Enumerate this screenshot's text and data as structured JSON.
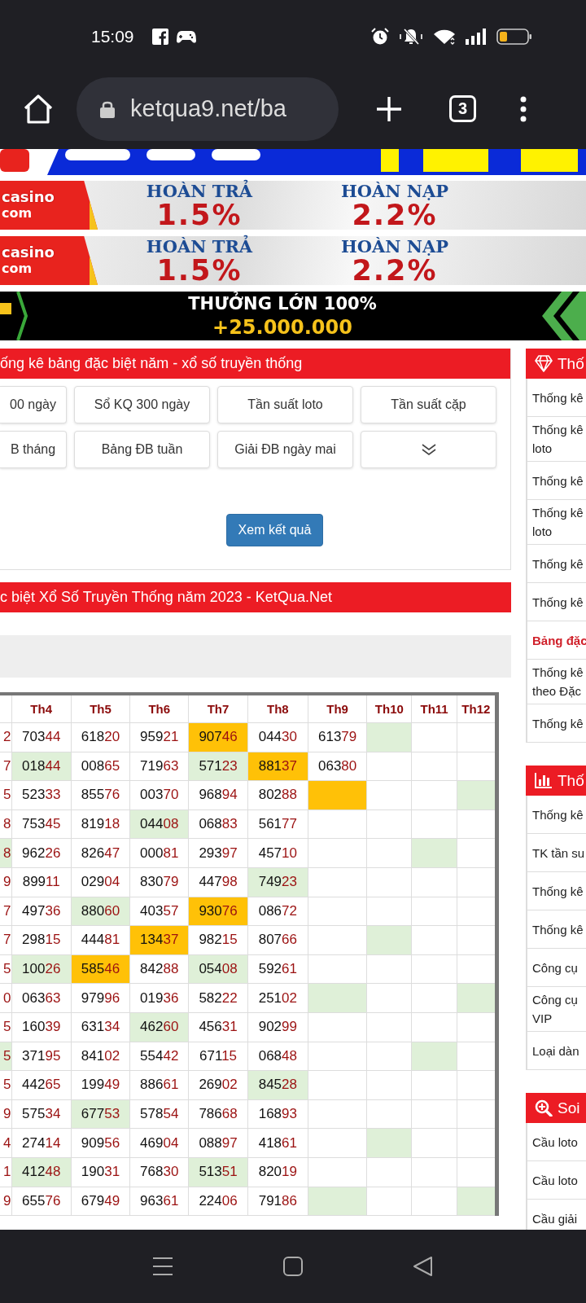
{
  "status_bar": {
    "time": "15:09"
  },
  "browser": {
    "url": "ketqua9.net/ba",
    "tab_count": "3"
  },
  "banners": [
    {
      "kind": "strip"
    },
    {
      "kind": "casino",
      "logo": "casino",
      "logo_sub": "com",
      "offers": [
        {
          "title": "HOÀN TRẢ",
          "value": "1.5%"
        },
        {
          "title": "HOÀN NẠP",
          "value": "2.2%"
        }
      ]
    },
    {
      "kind": "casino",
      "logo": "casino",
      "logo_sub": "com",
      "offers": [
        {
          "title": "HOÀN TRẢ",
          "value": "1.5%"
        },
        {
          "title": "HOÀN NẠP",
          "value": "2.2%"
        }
      ]
    },
    {
      "kind": "bonus",
      "title": "THƯỞNG LỚN 100%",
      "amount": "+25.000.000"
    }
  ],
  "filter_panel": {
    "title": "ống kê bảng đặc biệt năm - xổ số truyền thống",
    "options": [
      "00 ngày",
      "Sổ KQ 300 ngày",
      "Tần suất loto",
      "Tần suất cặp",
      "B tháng",
      "Bảng ĐB tuần",
      "Giải ĐB ngày mai"
    ],
    "submit": "Xem kết quả"
  },
  "table_panel": {
    "title": "c biệt Xổ Số Truyền Thống năm 2023 - KetQua.Net",
    "columns": [
      "",
      "Th4",
      "Th5",
      "Th6",
      "Th7",
      "Th8",
      "Th9",
      "Th10",
      "Th11",
      "Th12"
    ],
    "rows": [
      {
        "cells": [
          {
            "value": "2"
          },
          {
            "value": "70344"
          },
          {
            "value": "61820"
          },
          {
            "value": "95921"
          },
          {
            "value": "90746",
            "color": "#ffc107"
          },
          {
            "value": "04430"
          },
          {
            "value": "61379"
          },
          {
            "color": "#dff0d8"
          },
          {},
          {}
        ]
      },
      {
        "cells": [
          {
            "value": "7"
          },
          {
            "value": "01844",
            "color": "#dff0d8"
          },
          {
            "value": "00865"
          },
          {
            "value": "71963"
          },
          {
            "value": "57123",
            "color": "#dff0d8"
          },
          {
            "value": "88137",
            "color": "#ffc107"
          },
          {
            "value": "06380"
          },
          {},
          {},
          {}
        ]
      },
      {
        "cells": [
          {
            "value": "5"
          },
          {
            "value": "52333"
          },
          {
            "value": "85576"
          },
          {
            "value": "00370"
          },
          {
            "value": "96894"
          },
          {
            "value": "80288"
          },
          {
            "color": "#ffc107"
          },
          {},
          {},
          {
            "color": "#dff0d8"
          }
        ]
      },
      {
        "cells": [
          {
            "value": "8"
          },
          {
            "value": "75345"
          },
          {
            "value": "81918"
          },
          {
            "value": "04408",
            "color": "#dff0d8"
          },
          {
            "value": "06883"
          },
          {
            "value": "56177"
          },
          {},
          {},
          {},
          {}
        ]
      },
      {
        "cells": [
          {
            "value": "8",
            "color": "#dff0d8"
          },
          {
            "value": "96226"
          },
          {
            "value": "82647"
          },
          {
            "value": "00081"
          },
          {
            "value": "29397"
          },
          {
            "value": "45710"
          },
          {},
          {},
          {
            "color": "#dff0d8"
          },
          {}
        ]
      },
      {
        "cells": [
          {
            "value": "9"
          },
          {
            "value": "89911"
          },
          {
            "value": "02904"
          },
          {
            "value": "83079"
          },
          {
            "value": "44798"
          },
          {
            "value": "74923",
            "color": "#dff0d8"
          },
          {},
          {},
          {},
          {}
        ]
      },
      {
        "cells": [
          {
            "value": "7"
          },
          {
            "value": "49736"
          },
          {
            "value": "88060",
            "color": "#dff0d8"
          },
          {
            "value": "40357"
          },
          {
            "value": "93076",
            "color": "#ffc107"
          },
          {
            "value": "08672"
          },
          {},
          {},
          {},
          {}
        ]
      },
      {
        "cells": [
          {
            "value": "7"
          },
          {
            "value": "29815"
          },
          {
            "value": "44481"
          },
          {
            "value": "13437",
            "color": "#ffc107"
          },
          {
            "value": "98215"
          },
          {
            "value": "80766"
          },
          {},
          {
            "color": "#dff0d8"
          },
          {},
          {}
        ]
      },
      {
        "cells": [
          {
            "value": "5"
          },
          {
            "value": "10026",
            "color": "#dff0d8"
          },
          {
            "value": "58546",
            "color": "#ffc107"
          },
          {
            "value": "84288"
          },
          {
            "value": "05408",
            "color": "#dff0d8"
          },
          {
            "value": "59261"
          },
          {},
          {},
          {},
          {}
        ]
      },
      {
        "cells": [
          {
            "value": "0"
          },
          {
            "value": "06363"
          },
          {
            "value": "97996"
          },
          {
            "value": "01936"
          },
          {
            "value": "58222"
          },
          {
            "value": "25102"
          },
          {
            "color": "#dff0d8"
          },
          {},
          {},
          {
            "color": "#dff0d8"
          }
        ]
      },
      {
        "cells": [
          {
            "value": "5"
          },
          {
            "value": "16039"
          },
          {
            "value": "63134"
          },
          {
            "value": "46260",
            "color": "#dff0d8"
          },
          {
            "value": "45631"
          },
          {
            "value": "90299"
          },
          {},
          {},
          {},
          {}
        ]
      },
      {
        "cells": [
          {
            "value": "5",
            "color": "#dff0d8"
          },
          {
            "value": "37195"
          },
          {
            "value": "84102"
          },
          {
            "value": "55442"
          },
          {
            "value": "67115"
          },
          {
            "value": "06848"
          },
          {},
          {},
          {
            "color": "#dff0d8"
          },
          {}
        ]
      },
      {
        "cells": [
          {
            "value": "5"
          },
          {
            "value": "44265"
          },
          {
            "value": "19949"
          },
          {
            "value": "88661"
          },
          {
            "value": "26902"
          },
          {
            "value": "84528",
            "color": "#dff0d8"
          },
          {},
          {},
          {},
          {}
        ]
      },
      {
        "cells": [
          {
            "value": "9"
          },
          {
            "value": "57534"
          },
          {
            "value": "67753",
            "color": "#dff0d8"
          },
          {
            "value": "57854"
          },
          {
            "value": "78668"
          },
          {
            "value": "16893"
          },
          {},
          {},
          {},
          {}
        ]
      },
      {
        "cells": [
          {
            "value": "4"
          },
          {
            "value": "27414"
          },
          {
            "value": "90956"
          },
          {
            "value": "46904"
          },
          {
            "value": "08897"
          },
          {
            "value": "41861"
          },
          {},
          {
            "color": "#dff0d8"
          },
          {},
          {}
        ]
      },
      {
        "cells": [
          {
            "value": "1"
          },
          {
            "value": "41248",
            "color": "#dff0d8"
          },
          {
            "value": "19031"
          },
          {
            "value": "76830"
          },
          {
            "value": "51351",
            "color": "#dff0d8"
          },
          {
            "value": "82019"
          },
          {},
          {},
          {},
          {}
        ]
      },
      {
        "cells": [
          {
            "value": "9"
          },
          {
            "value": "65576"
          },
          {
            "value": "67949"
          },
          {
            "value": "96361"
          },
          {
            "value": "22406"
          },
          {
            "value": "79186"
          },
          {
            "color": "#dff0d8"
          },
          {},
          {},
          {
            "color": "#dff0d8"
          }
        ]
      }
    ]
  },
  "sidebar": [
    {
      "title": "Thố",
      "items": [
        {
          "kind": "link",
          "text": "Thống kê"
        },
        {
          "kind": "link",
          "text": "Thống kê loto"
        },
        {
          "kind": "link",
          "text": "Thống kê"
        },
        {
          "kind": "link",
          "text": "Thống kê loto"
        },
        {
          "kind": "link",
          "text": "Thống kê"
        },
        {
          "kind": "link",
          "text": "Thống kê"
        },
        {
          "kind": "heading",
          "text": "Bảng đặc"
        },
        {
          "kind": "link",
          "text": "Thống kê theo Đặc"
        },
        {
          "kind": "link",
          "text": "Thống kê"
        }
      ]
    },
    {
      "title": "Thố",
      "items": [
        {
          "kind": "link",
          "text": "Thống kê"
        },
        {
          "kind": "link",
          "text": "TK tần su"
        },
        {
          "kind": "link",
          "text": "Thống kê"
        },
        {
          "kind": "link",
          "text": "Thống kê"
        },
        {
          "kind": "link",
          "text": "Công cụ"
        },
        {
          "kind": "link",
          "text": "Công cụ VIP"
        },
        {
          "kind": "link",
          "text": "Loại dàn"
        }
      ]
    },
    {
      "title": "Soi",
      "items": [
        {
          "kind": "link",
          "text": "Cầu loto"
        },
        {
          "kind": "link",
          "text": "Cầu loto"
        },
        {
          "kind": "link",
          "text": "Cầu giải"
        }
      ]
    }
  ]
}
